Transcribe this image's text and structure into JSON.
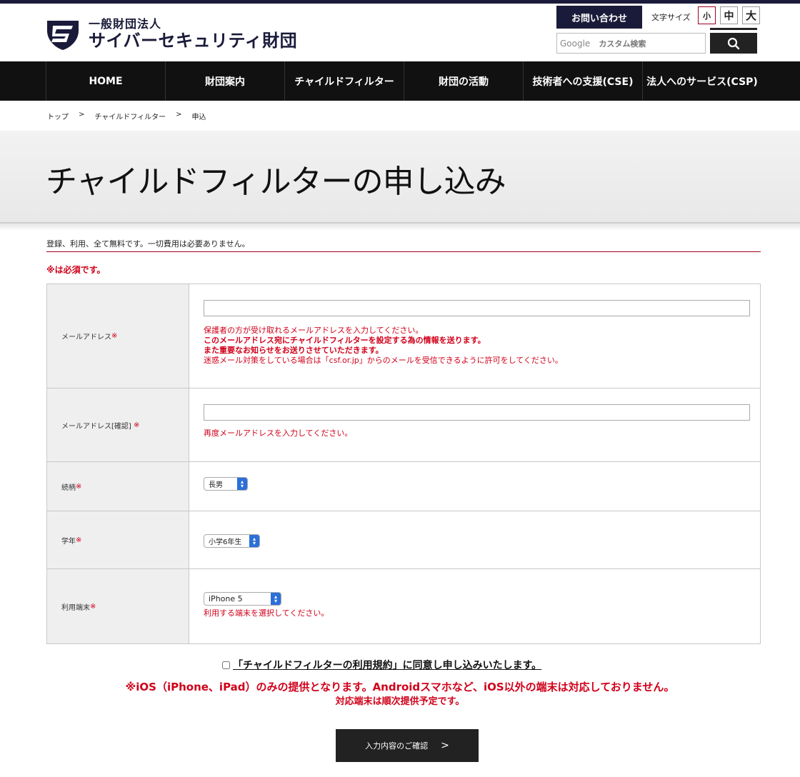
{
  "header": {
    "logo_sub": "一般財団法人",
    "logo_main": "サイバーセキュリティ財団",
    "contact_label": "お問い合わせ",
    "font_size_label": "文字サイズ",
    "font_sizes": [
      "小",
      "中",
      "大"
    ],
    "search_brand": "Google",
    "search_placeholder": "カスタム検索"
  },
  "nav": {
    "items": [
      "HOME",
      "財団案内",
      "チャイルドフィルター",
      "財団の活動",
      "技術者への支援(CSE)",
      "法人へのサービス(CSP)"
    ]
  },
  "breadcrumb": {
    "items": [
      "トップ",
      "チャイルドフィルター",
      "申込"
    ],
    "separator": ">"
  },
  "page": {
    "title": "チャイルドフィルターの申し込み",
    "intro": "登録、利用、全て無料です。一切費用は必要ありません。",
    "required_note": "※は必須です。"
  },
  "form": {
    "required_mark": "※",
    "email": {
      "label": "メールアドレス",
      "value": "",
      "hint1": "保護者の方が受け取れるメールアドレスを入力してください。",
      "hint2": "このメールアドレス宛にチャイルドフィルターを設定する為の情報を送ります。",
      "hint3": "また重要なお知らせをお送りさせていただきます。",
      "hint4": "迷惑メール対策をしている場合は「csf.or.jp」からのメールを受信できるように許可をしてください。"
    },
    "email_confirm": {
      "label": "メールアドレス[確認]",
      "value": "",
      "hint": "再度メールアドレスを入力してください。"
    },
    "relation": {
      "label": "続柄",
      "selected": "長男"
    },
    "grade": {
      "label": "学年",
      "selected": "小学6年生"
    },
    "device": {
      "label": "利用端末",
      "selected": "iPhone 5",
      "hint": "利用する端末を選択してください。"
    }
  },
  "agree": {
    "text": "「チャイルドフィルターの利用規約」に同意し申し込みいたします。",
    "checked": false
  },
  "warnings": {
    "line1": "※iOS（iPhone、iPad）のみの提供となります。Androidスマホなど、iOS以外の端末は対応しておりません。",
    "line2": "対応端末は順次提供予定です。"
  },
  "confirm": {
    "label": "入力内容のご確認",
    "chevron": ">"
  },
  "colors": {
    "brand_navy": "#1a1a3a",
    "required_red": "#d0001a",
    "nav_bg": "#111111"
  }
}
